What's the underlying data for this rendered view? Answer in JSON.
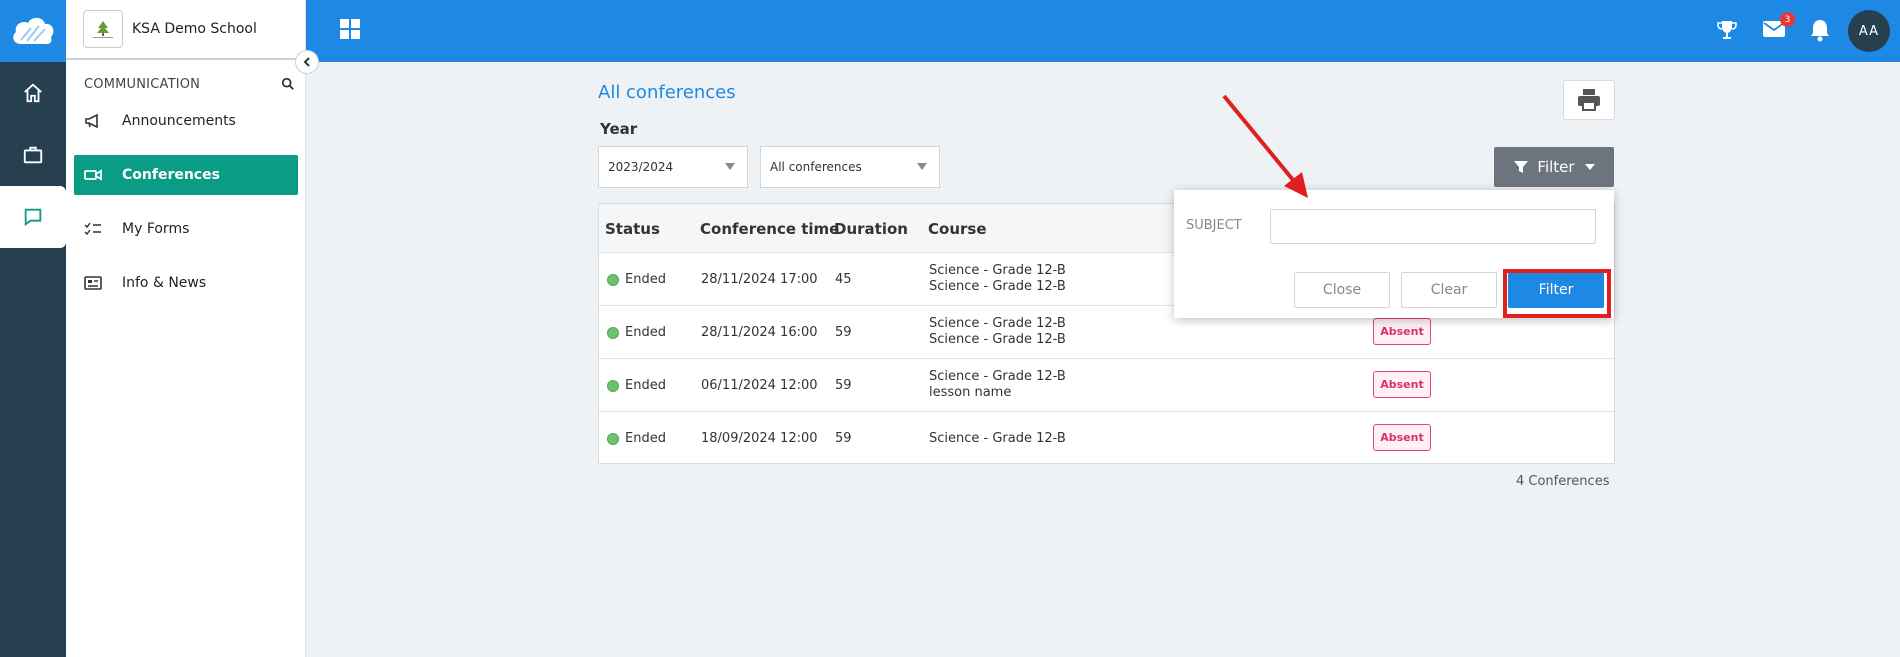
{
  "school": {
    "name": "KSA Demo School"
  },
  "sidebar": {
    "section_label": "COMMUNICATION",
    "items": [
      {
        "label": "Announcements",
        "icon": "megaphone-icon"
      },
      {
        "label": "Conferences",
        "icon": "video-icon",
        "active": true
      },
      {
        "label": "My Forms",
        "icon": "checklist-icon"
      },
      {
        "label": "Info & News",
        "icon": "news-icon"
      }
    ]
  },
  "topbar": {
    "mail_badge": "3",
    "avatar_initials": "AA"
  },
  "main": {
    "title": "All conferences",
    "year_label": "Year",
    "year_select": "2023/2024",
    "type_select": "All conferences",
    "filter_button": "Filter",
    "table": {
      "headers": [
        "Status",
        "Conference time",
        "Duration",
        "Course"
      ],
      "rows": [
        {
          "status": "Ended",
          "time": "28/11/2024 17:00",
          "duration": "45",
          "course1": "Science - Grade 12-B",
          "course2": "Science - Grade 12-B",
          "attendance": ""
        },
        {
          "status": "Ended",
          "time": "28/11/2024 16:00",
          "duration": "59",
          "course1": "Science - Grade 12-B",
          "course2": "Science - Grade 12-B",
          "attendance": "Absent"
        },
        {
          "status": "Ended",
          "time": "06/11/2024 12:00",
          "duration": "59",
          "course1": "Science - Grade 12-B",
          "course2": "lesson name",
          "attendance": "Absent"
        },
        {
          "status": "Ended",
          "time": "18/09/2024 12:00",
          "duration": "59",
          "course1": "Science - Grade 12-B",
          "course2": "",
          "attendance": "Absent"
        }
      ]
    },
    "count_text": "4 Conferences"
  },
  "filter_popup": {
    "subject_label": "SUBJECT",
    "subject_value": "",
    "close_label": "Close",
    "clear_label": "Clear",
    "filter_label": "Filter"
  },
  "colors": {
    "brand_blue": "#1e88e5",
    "rail_dark": "#26404f",
    "active_teal": "#0a9c84",
    "absent_pink": "#d6336c",
    "annotation_red": "#e02020"
  }
}
